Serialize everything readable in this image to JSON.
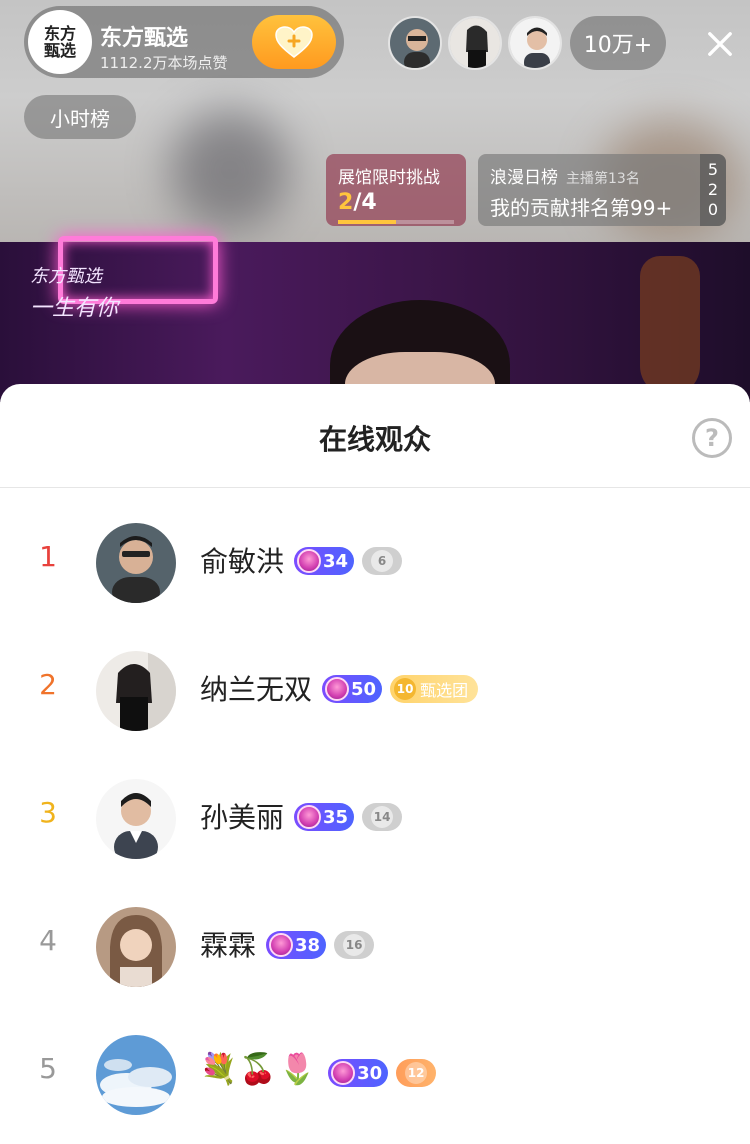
{
  "host": {
    "name": "东方甄选",
    "likes": "1112.2万本场点赞",
    "avatar_text": "东方甄选"
  },
  "viewer_count": "10万+",
  "hour_rank_label": "小时榜",
  "challenge": {
    "title": "展馆限时挑战",
    "progress_current": "2",
    "progress_total": "/4",
    "progress_fraction": 0.5
  },
  "romance": {
    "title": "浪漫日榜",
    "host_rank": "主播第13名",
    "my_rank": "我的贡献排名第99+",
    "side_number": "520"
  },
  "video_logo": {
    "line1": "东方甄选",
    "line2": "一生有你"
  },
  "sheet": {
    "title": "在线观众",
    "help_symbol": "?"
  },
  "viewers": [
    {
      "rank": "1",
      "name": "俞敏洪",
      "level": "34",
      "fan": "6",
      "fan_text": "",
      "rank_color": "#e8413c"
    },
    {
      "rank": "2",
      "name": "纳兰无双",
      "level": "50",
      "fan": "10",
      "fan_text": "甄选团",
      "rank_color": "#f0732b"
    },
    {
      "rank": "3",
      "name": "孙美丽",
      "level": "35",
      "fan": "14",
      "fan_text": "",
      "rank_color": "#f0b31c"
    },
    {
      "rank": "4",
      "name": "霖霖",
      "level": "38",
      "fan": "16",
      "fan_text": "",
      "rank_color": "#999999"
    },
    {
      "rank": "5",
      "name": "💐🍒🌷",
      "level": "30",
      "fan": "12",
      "fan_text": "",
      "rank_color": "#999999"
    }
  ]
}
